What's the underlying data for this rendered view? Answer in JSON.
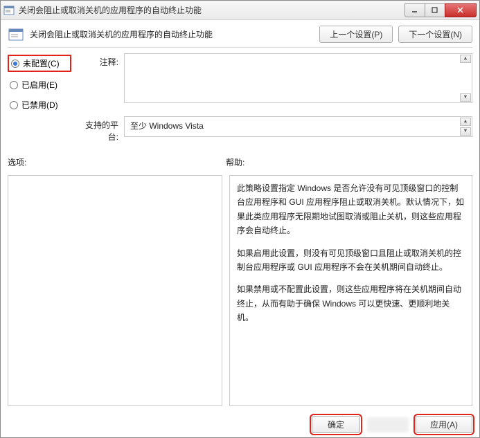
{
  "titlebar": {
    "title": "关闭会阻止或取消关机的应用程序的自动终止功能"
  },
  "header": {
    "title": "关闭会阻止或取消关机的应用程序的自动终止功能",
    "prev_btn": "上一个设置(P)",
    "next_btn": "下一个设置(N)"
  },
  "radios": {
    "not_configured": "未配置(C)",
    "enabled": "已启用(E)",
    "disabled": "已禁用(D)",
    "selected": "not_configured"
  },
  "labels": {
    "comment": "注释:",
    "platform": "支持的平台:",
    "options": "选项:",
    "help": "帮助:"
  },
  "platform": {
    "value": "至少 Windows Vista"
  },
  "help": {
    "p1": "此策略设置指定 Windows 是否允许没有可见顶级窗口的控制台应用程序和 GUI 应用程序阻止或取消关机。默认情况下，如果此类应用程序无限期地试图取消或阻止关机，则这些应用程序会自动终止。",
    "p2": "如果启用此设置，则没有可见顶级窗口且阻止或取消关机的控制台应用程序或 GUI 应用程序不会在关机期间自动终止。",
    "p3": "如果禁用或不配置此设置，则这些应用程序将在关机期间自动终止，从而有助于确保 Windows 可以更快速、更顺利地关机。"
  },
  "footer": {
    "ok": "确定",
    "apply": "应用(A)"
  }
}
